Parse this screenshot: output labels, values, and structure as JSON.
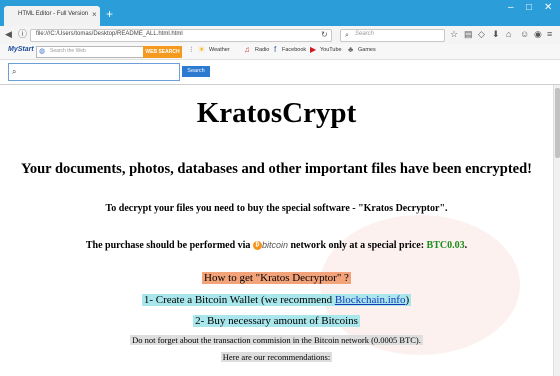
{
  "browser": {
    "tab_title": "HTML Editor - Full Version",
    "tab_close": "×",
    "new_tab": "+",
    "url": "file:///C:/Users/tomas/Desktop/README_ALL.html.html",
    "search_placeholder": "Search",
    "window_controls": [
      "–",
      "□",
      "✕"
    ]
  },
  "mystart_toolbar": {
    "logo": "MyStart",
    "search_placeholder": "Search the Web",
    "search_button": "WEB SEARCH",
    "links": [
      "Weather",
      "Radio",
      "Facebook",
      "YouTube",
      "Games"
    ]
  },
  "page_search": {
    "button": "Search"
  },
  "page": {
    "heading": "KratosCrypt",
    "encrypted_message": "Your documents, photos, databases and other important files have been encrypted!",
    "decrypt_message": "To decrypt your files you need to buy the special software - \"Kratos Decryptor\".",
    "purchase_prefix": "The purchase should be performed via ",
    "purchase_bitcoin_symbol": "₿",
    "purchase_bitcoin_word": "bitcoin",
    "purchase_middle": " network only at a special price: ",
    "purchase_amount": "BTC0.03",
    "purchase_suffix": ".",
    "how_to": "How to get \"Kratos Decryptor\" ?",
    "step1_prefix": "1- Create a Bitcoin Wallet (we recommend ",
    "step1_link": "Blockchain.info",
    "step1_suffix": ")",
    "step2": "2- Buy necessary amount of Bitcoins",
    "commission_note": "Do not forget about the transaction commision in the Bitcoin network (0.0005 BTC).",
    "recommendations": "Here are our recommendations:"
  },
  "colors": {
    "titlebar": "#2b9ed9",
    "btc_amount": "#1a8c1a",
    "orange_highlight": "#f2a37a",
    "cyan_highlight": "#a9e7ec",
    "grey_highlight": "#dedede"
  }
}
